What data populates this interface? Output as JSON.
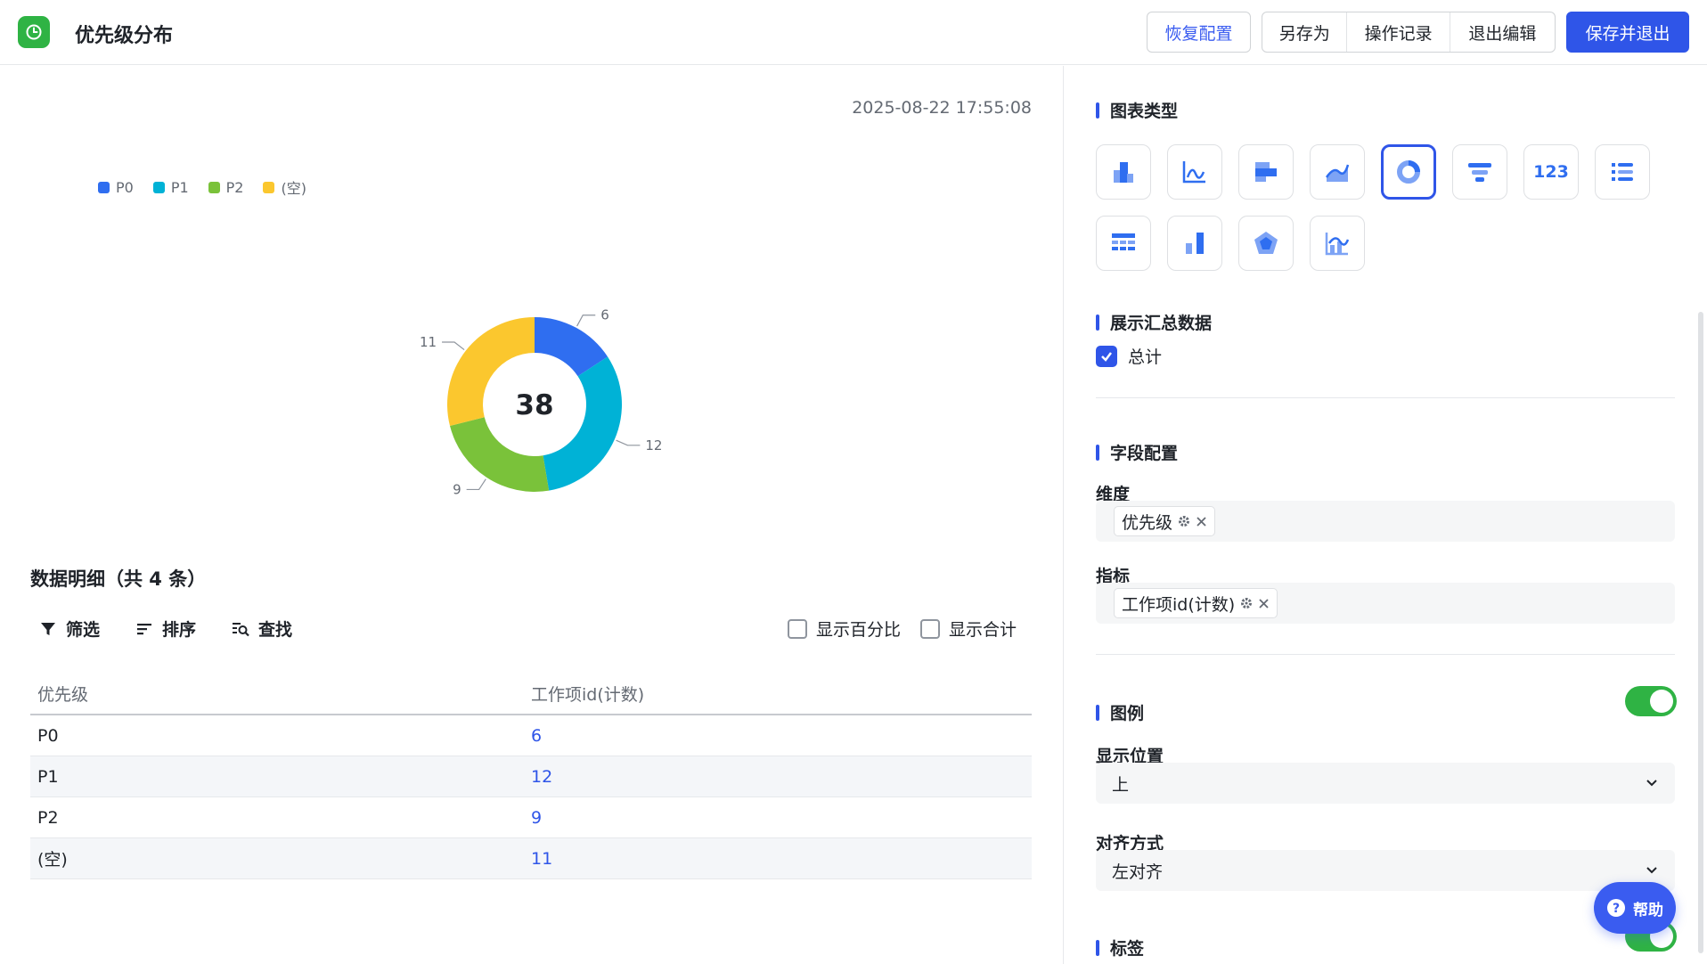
{
  "header": {
    "title": "优先级分布",
    "restore_label": "恢复配置",
    "save_as_label": "另存为",
    "history_label": "操作记录",
    "exit_edit_label": "退出编辑",
    "save_exit_label": "保存并退出"
  },
  "timestamp": "2025-08-22 17:55:08",
  "chart_data": {
    "type": "pie",
    "donut": true,
    "categories": [
      "P0",
      "P1",
      "P2",
      "(空)"
    ],
    "values": [
      6,
      12,
      9,
      11
    ],
    "colors": [
      "#2f6ef0",
      "#00b2d6",
      "#7ac23a",
      "#fbc72e"
    ],
    "total_label": "38",
    "legend_position": "top-left"
  },
  "detail": {
    "title": "数据明细（共 4 条）",
    "filter_label": "筛选",
    "sort_label": "排序",
    "find_label": "查找",
    "show_percent_label": "显示百分比",
    "show_total_label": "显示合计",
    "columns": [
      "优先级",
      "工作项id(计数)"
    ],
    "rows": [
      {
        "priority": "P0",
        "count": "6"
      },
      {
        "priority": "P1",
        "count": "12"
      },
      {
        "priority": "P2",
        "count": "9"
      },
      {
        "priority": "(空)",
        "count": "11"
      }
    ]
  },
  "panel": {
    "chart_type_title": "图表类型",
    "chart_types": [
      "bar-chart-icon",
      "line-chart-icon",
      "horizontal-bar-icon",
      "area-chart-icon",
      "donut-chart-icon",
      "funnel-chart-icon",
      "number-card-icon",
      "list-icon",
      "pivot-table-icon",
      "waterfall-icon",
      "radar-chart-icon",
      "combo-chart-icon"
    ],
    "chart_type_123": "123",
    "summary_title": "展示汇总数据",
    "summary_total_label": "总计",
    "field_title": "字段配置",
    "dimension_label": "维度",
    "dimension_tag": "优先级",
    "metric_label": "指标",
    "metric_tag": "工作项id(计数)",
    "legend_title": "图例",
    "position_label": "显示位置",
    "position_value": "上",
    "align_label": "对齐方式",
    "align_value": "左对齐",
    "tag_title": "标签"
  },
  "help_label": "帮助"
}
